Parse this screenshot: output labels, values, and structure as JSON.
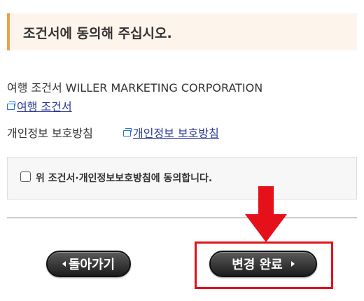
{
  "header": {
    "title": "조건서에 동의해 주십시오."
  },
  "terms": {
    "description": "여행 조건서 WILLER MARKETING CORPORATION",
    "link_label": "여행 조건서"
  },
  "privacy": {
    "label": "개인정보 보호방침",
    "link_label": "개인정보 보호방침"
  },
  "agreement": {
    "checkbox_label": "위 조건서·개인정보보호방침에 동의합니다.",
    "checked": false
  },
  "buttons": {
    "back_label": "돌아가기",
    "complete_label": "변경 완료"
  },
  "colors": {
    "accent_border": "#e8a14b",
    "header_bg": "#fdf5ec",
    "link": "#2b3a9e",
    "annotation_red": "#e5101a"
  },
  "icons": {
    "external_link": "external-link-icon",
    "back": "triangle-left-icon",
    "forward": "triangle-right-icon",
    "annotation": "down-arrow-icon"
  }
}
